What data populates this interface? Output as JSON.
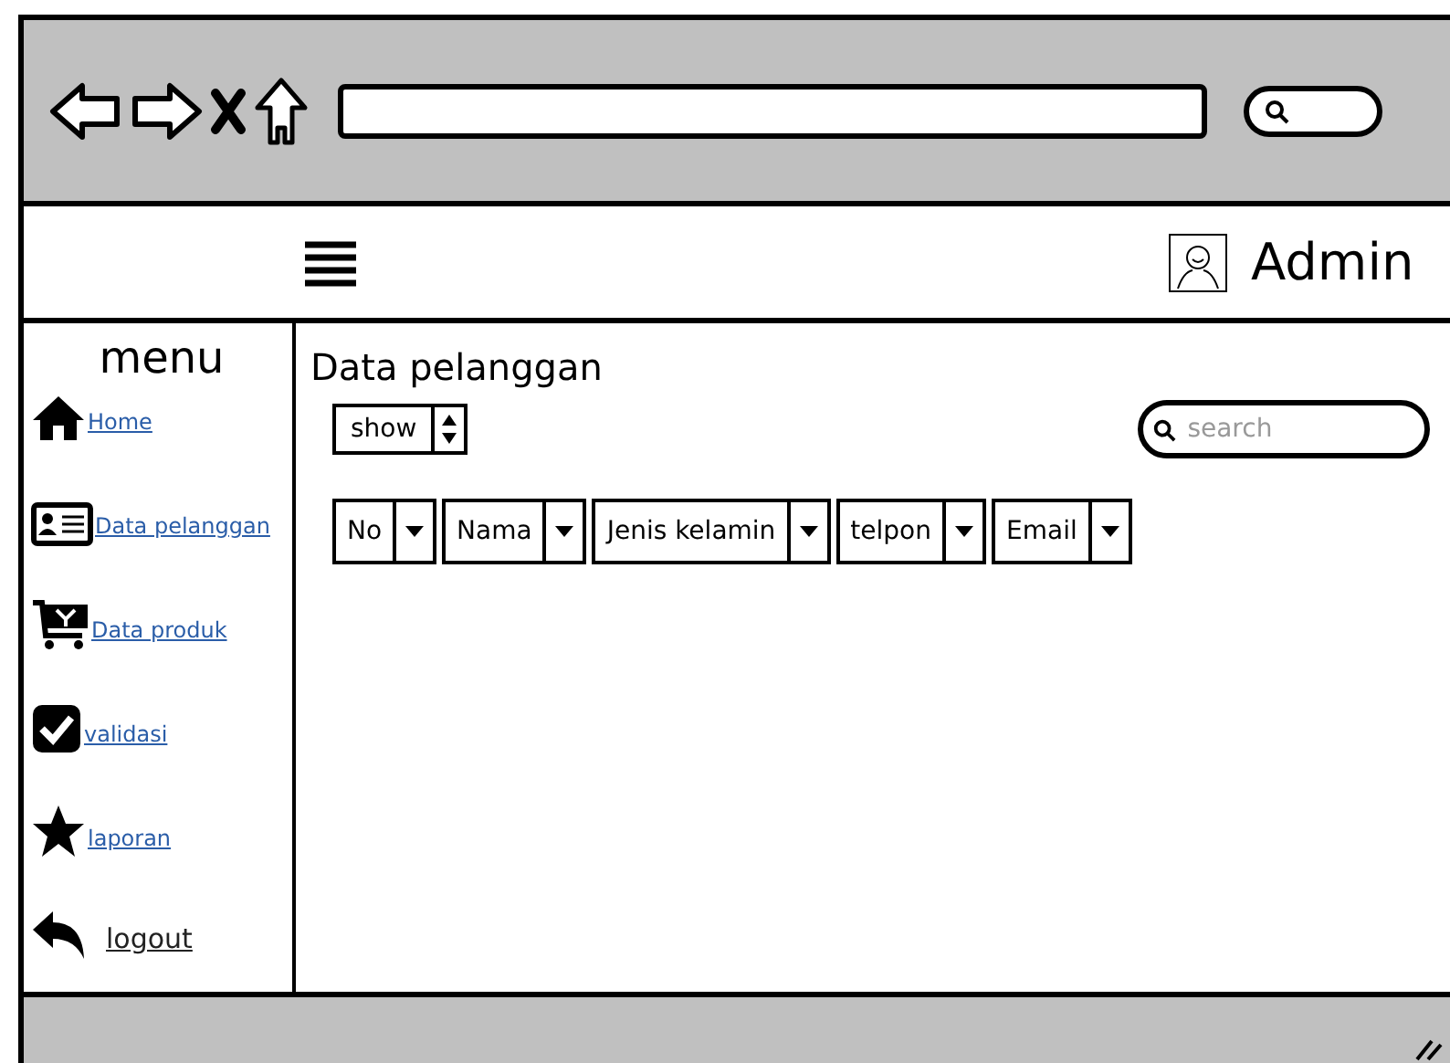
{
  "header": {
    "user": "Admin"
  },
  "sidebar": {
    "title": "menu",
    "items": [
      {
        "label": "Home"
      },
      {
        "label": "Data pelanggan"
      },
      {
        "label": "Data produk"
      },
      {
        "label": "validasi"
      },
      {
        "label": "laporan"
      },
      {
        "label": "logout"
      }
    ]
  },
  "main": {
    "title": "Data pelanggan",
    "show_select": {
      "value": "show"
    },
    "search": {
      "placeholder": "search"
    },
    "table": {
      "columns": [
        "No",
        "Nama",
        "Jenis kelamin",
        "telpon",
        "Email"
      ]
    }
  }
}
